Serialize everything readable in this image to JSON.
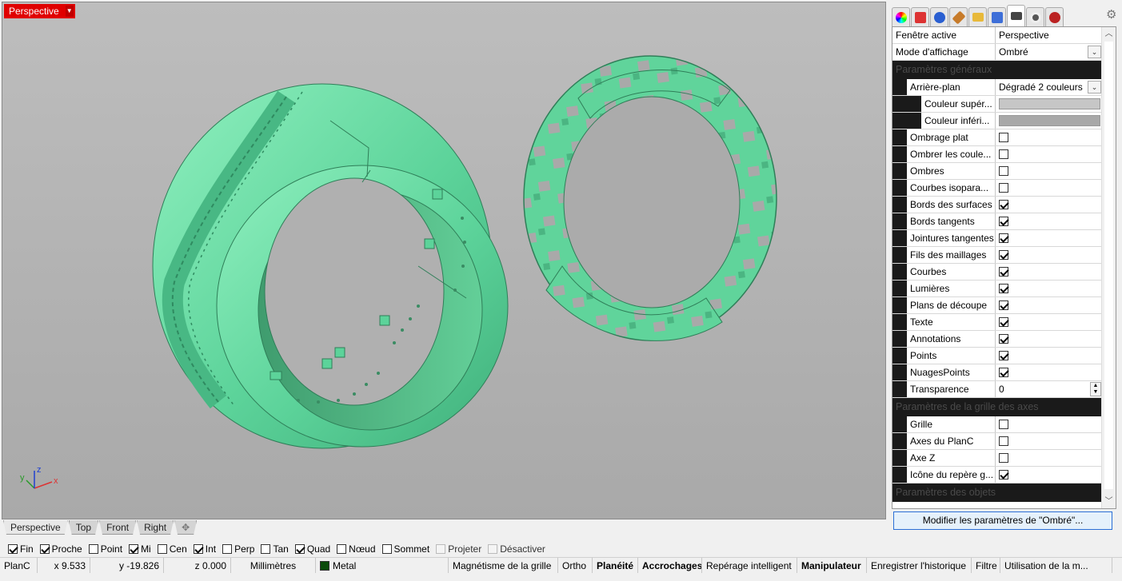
{
  "viewport": {
    "title": "Perspective",
    "background_top": "#bdbdbd",
    "background_bottom": "#a9a9a9",
    "model_color": "#5fd39a",
    "axes": {
      "x": "x",
      "y": "y",
      "z": "z"
    },
    "objects": [
      "ring-with-channel",
      "cross-pattern-ring"
    ]
  },
  "viewport_tabs": [
    "Perspective",
    "Top",
    "Front",
    "Right"
  ],
  "osnap": [
    {
      "label": "Fin",
      "checked": true
    },
    {
      "label": "Proche",
      "checked": true
    },
    {
      "label": "Point",
      "checked": false
    },
    {
      "label": "Mi",
      "checked": true
    },
    {
      "label": "Cen",
      "checked": false
    },
    {
      "label": "Int",
      "checked": true
    },
    {
      "label": "Perp",
      "checked": false
    },
    {
      "label": "Tan",
      "checked": false
    },
    {
      "label": "Quad",
      "checked": true
    },
    {
      "label": "Nœud",
      "checked": false
    },
    {
      "label": "Sommet",
      "checked": false
    },
    {
      "label": "Projeter",
      "checked": false,
      "disabled": true
    },
    {
      "label": "Désactiver",
      "checked": false,
      "disabled": true
    }
  ],
  "statusbar": {
    "cplane": "PlanC",
    "x": "x 9.533",
    "y": "y -19.826",
    "z": "z 0.000",
    "units": "Millimètres",
    "layer": "Metal",
    "layer_color": "#0a4a0a",
    "grid_snap": "Magnétisme de la grille",
    "ortho": "Ortho",
    "planar": "Planéité",
    "osnap": "Accrochages",
    "smarttrack": "Repérage intelligent",
    "gumball": "Manipulateur",
    "history": "Enregistrer l'historique",
    "filter": "Filtre",
    "usage": "Utilisation de la m..."
  },
  "panel": {
    "tab_icons": [
      "color-icon",
      "layers-icon",
      "render-icon",
      "material-icon",
      "folder-icon",
      "library-icon",
      "display-icon",
      "help-icon",
      "environment-icon"
    ],
    "rows_top": [
      {
        "label": "Fenêtre active",
        "value": "Perspective"
      },
      {
        "label": "Mode d'affichage",
        "value": "Ombré",
        "dropdown": true
      }
    ],
    "section_general": "Paramètres généraux",
    "background": {
      "label": "Arrière-plan",
      "value": "Dégradé 2 couleurs"
    },
    "color_top": {
      "label": "Couleur supér...",
      "color": "#c6c6c6"
    },
    "color_bottom": {
      "label": "Couleur inféri...",
      "color": "#a8a8a8"
    },
    "checks": [
      {
        "label": "Ombrage plat",
        "checked": false
      },
      {
        "label": "Ombrer les coule...",
        "checked": false
      },
      {
        "label": "Ombres",
        "checked": false
      },
      {
        "label": "Courbes isopara...",
        "checked": false
      },
      {
        "label": "Bords des surfaces",
        "checked": true
      },
      {
        "label": "Bords tangents",
        "checked": true
      },
      {
        "label": "Jointures tangentes",
        "checked": true
      },
      {
        "label": "Fils des maillages",
        "checked": true
      },
      {
        "label": "Courbes",
        "checked": true
      },
      {
        "label": "Lumières",
        "checked": true
      },
      {
        "label": "Plans de découpe",
        "checked": true
      },
      {
        "label": "Texte",
        "checked": true
      },
      {
        "label": "Annotations",
        "checked": true
      },
      {
        "label": "Points",
        "checked": true
      },
      {
        "label": "NuagesPoints",
        "checked": true
      }
    ],
    "transparency": {
      "label": "Transparence",
      "value": "0"
    },
    "section_grid": "Paramètres de la grille des axes",
    "grid_checks": [
      {
        "label": "Grille",
        "checked": false
      },
      {
        "label": "Axes du PlanC",
        "checked": false
      },
      {
        "label": "Axe Z",
        "checked": false
      },
      {
        "label": "Icône du repère g...",
        "checked": true
      }
    ],
    "section_objects": "Paramètres des objets",
    "modify_button": "Modifier les paramètres de \"Ombré\"..."
  }
}
